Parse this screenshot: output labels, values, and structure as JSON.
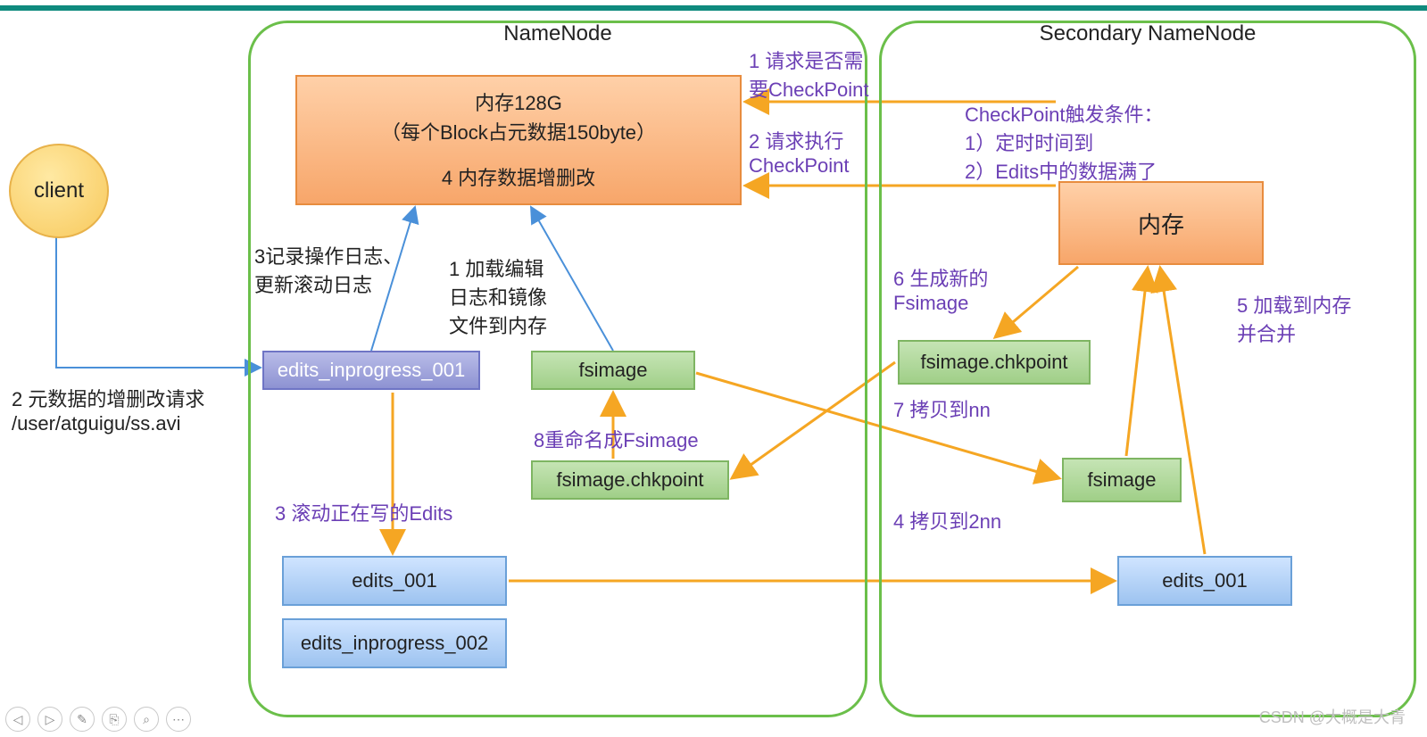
{
  "panels": {
    "namenode": "NameNode",
    "secondary": "Secondary NameNode"
  },
  "client": "client",
  "mem1": {
    "l1": "内存128G",
    "l2": "（每个Block占元数据150byte）",
    "l3": "4 内存数据增删改"
  },
  "mem2": "内存",
  "boxes": {
    "eip1": "edits_inprogress_001",
    "fsim": "fsimage",
    "fsck": "fsimage.chkpoint",
    "e001": "edits_001",
    "eip2": "edits_inprogress_002",
    "snn_fsck": "fsimage.chkpoint",
    "snn_fsim": "fsimage",
    "snn_e001": "edits_001"
  },
  "labels": {
    "req1": "1 请求是否需\n要CheckPoint",
    "req2": "2 请求执行\nCheckPoint",
    "chk": "CheckPoint触发条件：\n1）定时时间到\n2）Edits中的数据满了",
    "log3": "3记录操作日志、\n更新滚动日志",
    "load1": "1 加载编辑\n日志和镜像\n文件到内存",
    "meta": "2 元数据的增删改请求\n/user/atguigu/ss.avi",
    "gen6": "6 生成新的\nFsimage",
    "load5": "5 加载到内存\n并合并",
    "copy7": "7 拷贝到nn",
    "copy4": "4 拷贝到2nn",
    "roll3": "3 滚动正在写的Edits",
    "ren8": "8重命名成Fsimage"
  },
  "watermark": "CSDN @大概是大青",
  "toolbar": [
    "◁",
    "▷",
    "✎",
    "⎘",
    "⌕",
    "⋯"
  ],
  "colors": {
    "arrow_orange": "#f5a623",
    "arrow_blue": "#4a90d9"
  }
}
